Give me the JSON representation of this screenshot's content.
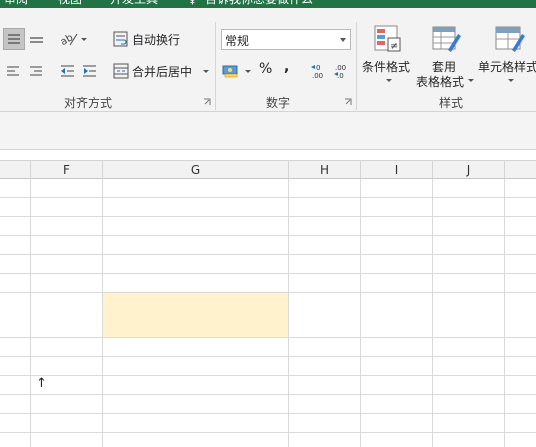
{
  "tabs": [
    "审阅",
    "视图",
    "开发工具",
    "告诉我你想要做什么"
  ],
  "ribbon": {
    "alignment": {
      "wrap_text": "自动换行",
      "merge_center": "合并后居中",
      "group_label": "对齐方式"
    },
    "number": {
      "format_value": "常规",
      "percent": "%",
      "comma": ",",
      "group_label": "数字"
    },
    "styles": {
      "conditional_formatting": "条件格式",
      "format_as_table_line1": "套用",
      "format_as_table_line2": "表格格式",
      "cell_styles": "单元格样式",
      "group_label": "样式"
    }
  },
  "columns": [
    "F",
    "G",
    "H",
    "I",
    "J"
  ],
  "colors": {
    "accent": "#217346",
    "highlight_cell": "#fff2cc"
  }
}
